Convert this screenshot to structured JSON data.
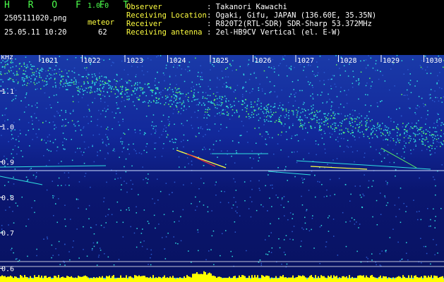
{
  "header": {
    "app_name": "H R O F F T",
    "version": "1.0.0",
    "filename": "2505111020.png",
    "meteor_label": "meteor",
    "datetime": "25.05.11 10:20",
    "meteor_count": "62",
    "fields": [
      {
        "label": "Observer",
        "value": ": Takanori Kawachi"
      },
      {
        "label": "Receiving Location",
        "value": ": Ogaki, Gifu, JAPAN (136.60E, 35.35N)"
      },
      {
        "label": "Receiver",
        "value": ": R820T2(RTL-SDR) SDR-Sharp 53.372MHz"
      },
      {
        "label": "Receiving antenna",
        "value": ": 2el-HB9CV Vertical (el. E-W)"
      }
    ]
  },
  "spectrogram": {
    "y_unit": "kHz",
    "x_ticks": [
      "1021",
      "1022",
      "1023",
      "1024",
      "1025",
      "1026",
      "1027",
      "1028",
      "1029",
      "1030"
    ],
    "y_ticks": [
      "1.1",
      "1.0",
      "0.9",
      "0.8",
      "0.7",
      "0.6"
    ],
    "colors": {
      "background": "#0a1670",
      "noise_light": "#2a5ad0",
      "signal_cyan": "#30e0e0",
      "signal_green": "#60ff60",
      "signal_yellow": "#ffff40",
      "signal_red": "#ff3030",
      "bottom_bar": "#ffff00",
      "bottom_bar_base": "#40c0ff"
    }
  }
}
